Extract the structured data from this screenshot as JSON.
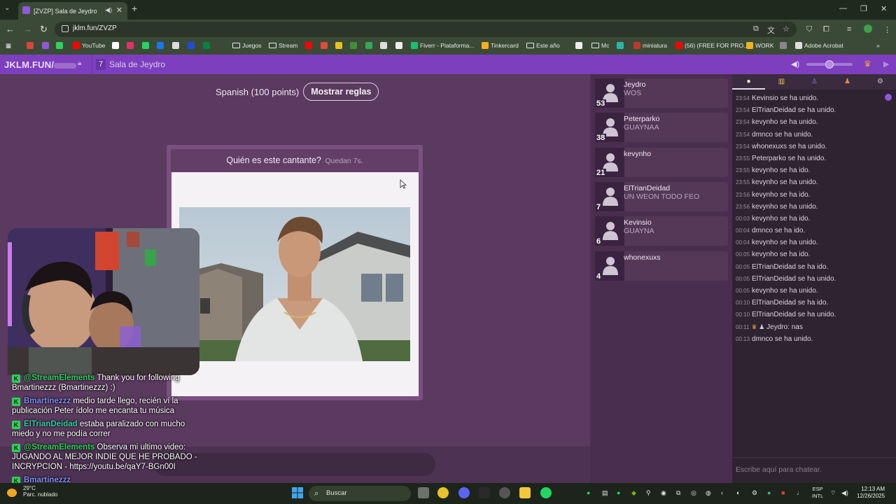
{
  "browser": {
    "tab_title": "[ZVZP] Sala de Jeydro",
    "url": "jklm.fun/ZVZP",
    "bookmarks": [
      {
        "label": "",
        "color": "#d9453a"
      },
      {
        "label": "",
        "color": "#8e59d6"
      },
      {
        "label": "",
        "color": "#2fd25a"
      },
      {
        "label": "YouTube",
        "color": "#ff0000"
      },
      {
        "label": "",
        "color": "#ffffff"
      },
      {
        "label": "",
        "color": "#e1306c"
      },
      {
        "label": "",
        "color": "#25d366"
      },
      {
        "label": "",
        "color": "#1877f2"
      },
      {
        "label": "",
        "color": "#dddddd"
      },
      {
        "label": "",
        "color": "#1d4ed8"
      },
      {
        "label": "",
        "color": "#0b8043"
      },
      {
        "label": "Juegos",
        "folder": true
      },
      {
        "label": "Stream",
        "folder": true
      },
      {
        "label": "",
        "color": "#ff0000"
      },
      {
        "label": "",
        "color": "#e04b3a"
      },
      {
        "label": "",
        "color": "#e8c21a"
      },
      {
        "label": "",
        "color": "#3f8f3a"
      },
      {
        "label": "",
        "color": "#34a853"
      },
      {
        "label": "",
        "color": "#dddddd"
      },
      {
        "label": "",
        "color": "#eeeeee"
      },
      {
        "label": "Fiverr - Plataforma...",
        "color": "#1dbf73"
      },
      {
        "label": "Tinkercard",
        "color": "#f2b01e"
      },
      {
        "label": "Este año",
        "folder": true
      },
      {
        "label": "",
        "color": "#eeeeee"
      },
      {
        "label": "Mc",
        "folder": true
      },
      {
        "label": "",
        "color": "#2ab7a9"
      },
      {
        "label": "miniatura",
        "color": "#c0392b"
      },
      {
        "label": "(56) (FREE FOR PRO...",
        "color": "#ff0000"
      },
      {
        "label": "WORK",
        "color": "#f2b01e"
      },
      {
        "label": "",
        "color": "#888888"
      },
      {
        "label": "Adobe Acrobat",
        "color": "#dddddd"
      }
    ]
  },
  "site": {
    "brand": "JKLM.FUN/",
    "room_number": "7",
    "room_name": "Sala de Jeydro"
  },
  "game": {
    "language": "Spanish (100 points)",
    "rules_button": "Mostrar reglas",
    "question": "Quién es este cantante?",
    "timer": "Quedan 7s."
  },
  "players": [
    {
      "name": "Jeydro",
      "message": "WOS",
      "score": "53"
    },
    {
      "name": "Peterparko",
      "message": "GUAYNAA",
      "score": "38"
    },
    {
      "name": "kevynho",
      "message": "",
      "score": "21"
    },
    {
      "name": "ElTrianDeidad",
      "message": "UN WEON TODO FEO",
      "score": "7"
    },
    {
      "name": "Kevinsio",
      "message": "GUAYNA",
      "score": "6"
    },
    {
      "name": "whonexuxs",
      "message": "",
      "score": "4"
    }
  ],
  "chat": {
    "tabs": [
      "chat",
      "book",
      "rank",
      "user",
      "settings"
    ],
    "log": [
      {
        "time": "23:54",
        "text": "Kevinsio se ha unido."
      },
      {
        "time": "23:54",
        "text": "ElTrianDeidad  se ha unido."
      },
      {
        "time": "23:54",
        "text": "kevynho se ha unido."
      },
      {
        "time": "23:54",
        "text": "dmnco se ha unido."
      },
      {
        "time": "23:54",
        "text": "whonexuxs se ha unido."
      },
      {
        "time": "23:55",
        "text": "Peterparko se ha unido."
      },
      {
        "time": "23:55",
        "text": "kevynho se ha ido."
      },
      {
        "time": "23:55",
        "text": "kevynho se ha unido."
      },
      {
        "time": "23:56",
        "text": "kevynho se ha ido."
      },
      {
        "time": "23:56",
        "text": "kevynho se ha unido."
      },
      {
        "time": "00:03",
        "text": "kevynho se ha ido."
      },
      {
        "time": "00:04",
        "text": "dmnco se ha ido."
      },
      {
        "time": "00:04",
        "text": "kevynho se ha unido."
      },
      {
        "time": "00:05",
        "text": "kevynho se ha ido."
      },
      {
        "time": "00:05",
        "text": "ElTrianDeidad  se ha ido."
      },
      {
        "time": "00:05",
        "text": "ElTrianDeidad  se ha unido."
      },
      {
        "time": "00:05",
        "text": "kevynho se ha unido."
      },
      {
        "time": "00:10",
        "text": "ElTrianDeidad  se ha ido."
      },
      {
        "time": "00:10",
        "text": "ElTrianDeidad  se ha unido."
      },
      {
        "time": "00:11",
        "text": "Jeydro: nas",
        "crown": true
      },
      {
        "time": "00:13",
        "text": "dmnco se ha unido."
      }
    ],
    "placeholder": "Escribe aquí para chatear."
  },
  "overlay": [
    {
      "user": "@StreamElements",
      "user_color": "#2fd25a",
      "text": "Thank you for following Bmartinezzz (Bmartinezzz) :)"
    },
    {
      "user": "Bmartinezzz",
      "user_color": "#7a8ef0",
      "text": "medio tarde llego, recién ví la publicación Peter ídolo me encanta tu música"
    },
    {
      "user": "ElTrianDeidad",
      "user_color": "#2fd2a0",
      "text": "estaba paralizado con mucho miedo y no me podía correr"
    },
    {
      "user": "@StreamElements",
      "user_color": "#2fd25a",
      "text": "Observa mi ultimo video: JUGANDO AL MEJOR INDIE QUE HE PROBADO - INCRYPCION - https://youtu.be/qaY7-BGn00I"
    },
    {
      "user": "Bmartinezzz",
      "user_color": "#7a8ef0",
      "text": ""
    }
  ],
  "taskbar": {
    "weather_temp": "29°C",
    "weather_desc": "Parc. nublado",
    "search": "Buscar",
    "lang_top": "ESP",
    "lang_bottom": "INTL",
    "time": "12:13 AM",
    "date": "12/26/2025"
  }
}
